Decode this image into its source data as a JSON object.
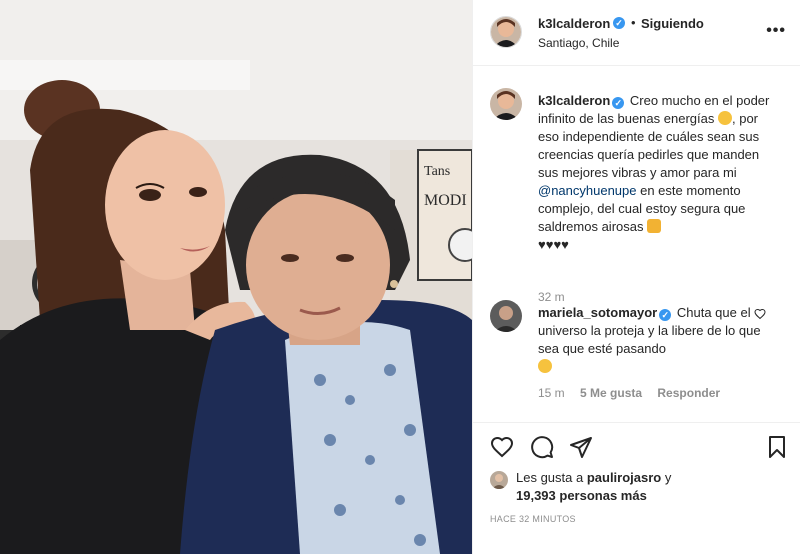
{
  "post": {
    "username": "k3lcalderon",
    "follow_status": "Siguiendo",
    "separator": "•",
    "location": "Santiago, Chile",
    "more": "•••"
  },
  "caption": {
    "username": "k3lcalderon",
    "text_1": "Creo mucho en el poder infinito de las buenas energías",
    "text_2": ", por eso independiente de cuáles sean sus creencias quería pedirles que manden sus mejores vibras y amor para mi ",
    "mention": "@nancyhuenupe",
    "text_3": " en este momento complejo, del cual estoy segura que saldremos airosas ",
    "hearts": "♥♥♥♥",
    "time": "32 m"
  },
  "comment": {
    "username": "mariela_sotomayor",
    "text": "Chuta que el universo la proteja y la libere de lo que sea que esté pasando",
    "time": "15 m",
    "likes": "5 Me gusta",
    "reply": "Responder"
  },
  "likes": {
    "prefix": "Les gusta a ",
    "user": "paulirojasro",
    "connector": " y",
    "count": "19,393 personas más"
  },
  "timeago": "HACE 32 MINUTOS",
  "icons": [
    "verified-badge",
    "heart-icon",
    "comment-icon",
    "share-icon",
    "bookmark-icon",
    "more-icon"
  ],
  "colors": {
    "verified": "#3897f0",
    "mention": "#00376b",
    "secondary": "#8e8e8e"
  }
}
